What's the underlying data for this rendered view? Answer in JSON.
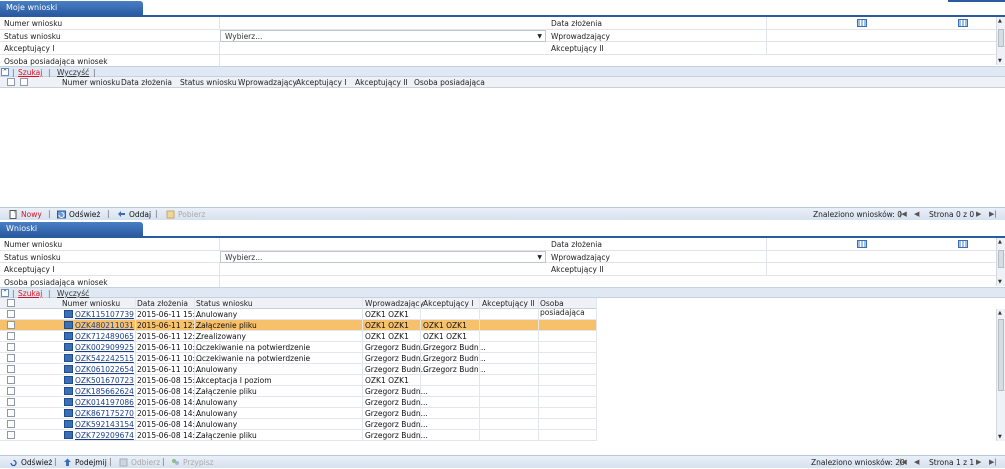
{
  "panel1": {
    "tab": "Moje wnioski",
    "filters": {
      "numer_label": "Numer wniosku",
      "status_label": "Status wniosku",
      "status_value": "Wybierz...",
      "akcept1_label": "Akceptujący I",
      "osoba_label": "Osoba posiadająca wniosek",
      "data_label": "Data złożenia",
      "wprow_label": "Wprowadzający",
      "akcept2_label": "Akceptujący II"
    },
    "search": {
      "szukaj": "Szukaj",
      "wyczysc": "Wyczyść"
    },
    "columns": [
      "Numer wniosku",
      "Data złożenia",
      "Status wniosku",
      "Wprowadzający",
      "Akceptujący I",
      "Akceptujący II",
      "Osoba posiadająca"
    ],
    "toolbar": {
      "nowy": "Nowy",
      "odswiez": "Odśwież",
      "oddaj": "Oddaj",
      "pobierz": "Pobierz"
    },
    "found": "Znaleziono wniosków: 0",
    "page": "Strona 0 z 0"
  },
  "panel2": {
    "tab": "Wnioski",
    "filters": {
      "numer_label": "Numer wniosku",
      "status_label": "Status wniosku",
      "status_value": "Wybierz...",
      "akcept1_label": "Akceptujący I",
      "osoba_label": "Osoba posiadająca wniosek",
      "data_label": "Data złożenia",
      "wprow_label": "Wprowadzający",
      "akcept2_label": "Akceptujący II"
    },
    "search": {
      "szukaj": "Szukaj",
      "wyczysc": "Wyczyść"
    },
    "columns": [
      "Numer wniosku",
      "Data złożenia",
      "Status wniosku",
      "Wprowadzający",
      "Akceptujący I",
      "Akceptujący II",
      "Osoba posiadająca"
    ],
    "rows": [
      {
        "num": "OZK115107739",
        "date": "2015-06-11 15:...",
        "status": "Anulowany",
        "wprow": "OZK1 OZK1",
        "ak1": "",
        "ak2": ""
      },
      {
        "num": "OZK480211031",
        "date": "2015-06-11 12:...",
        "status": "Załączenie pliku",
        "wprow": "OZK1 OZK1",
        "ak1": "OZK1 OZK1",
        "ak2": ""
      },
      {
        "num": "OZK712489065",
        "date": "2015-06-11 12:...",
        "status": "Zrealizowany",
        "wprow": "OZK1 OZK1",
        "ak1": "OZK1 OZK1",
        "ak2": ""
      },
      {
        "num": "OZK002909925",
        "date": "2015-06-11 10:...",
        "status": "Oczekiwanie na potwierdzenie",
        "wprow": "Grzegorz Budn...",
        "ak1": "Grzegorz Budn...",
        "ak2": ""
      },
      {
        "num": "OZK542242515",
        "date": "2015-06-11 10:...",
        "status": "Oczekiwanie na potwierdzenie",
        "wprow": "Grzegorz Budn...",
        "ak1": "Grzegorz Budn...",
        "ak2": ""
      },
      {
        "num": "OZK061022654",
        "date": "2015-06-11 10:...",
        "status": "Anulowany",
        "wprow": "Grzegorz Budn...",
        "ak1": "Grzegorz Budn...",
        "ak2": ""
      },
      {
        "num": "OZK501670723",
        "date": "2015-06-08 15:...",
        "status": "Akceptacja I poziom",
        "wprow": "OZK1 OZK1",
        "ak1": "",
        "ak2": ""
      },
      {
        "num": "OZK185662624",
        "date": "2015-06-08 14:...",
        "status": "Załączenie pliku",
        "wprow": "Grzegorz Budn...",
        "ak1": "",
        "ak2": ""
      },
      {
        "num": "OZK014197086",
        "date": "2015-06-08 14:...",
        "status": "Anulowany",
        "wprow": "Grzegorz Budn...",
        "ak1": "",
        "ak2": ""
      },
      {
        "num": "OZK867175270",
        "date": "2015-06-08 14:...",
        "status": "Anulowany",
        "wprow": "Grzegorz Budn...",
        "ak1": "",
        "ak2": ""
      },
      {
        "num": "OZK592143154",
        "date": "2015-06-08 14:...",
        "status": "Anulowany",
        "wprow": "Grzegorz Budn...",
        "ak1": "",
        "ak2": ""
      },
      {
        "num": "OZK729209674",
        "date": "2015-06-08 14:...",
        "status": "Załączenie pliku",
        "wprow": "Grzegorz Budn...",
        "ak1": "",
        "ak2": ""
      }
    ],
    "selected_row": 1,
    "toolbar": {
      "odswiez": "Odśwież",
      "podejmij": "Podejmij",
      "odbierz": "Odbierz",
      "przypisz": "Przypisz"
    },
    "found": "Znaleziono wniosków: 20",
    "page": "Strona 1 z 1"
  },
  "colors": {
    "accent": "#2a5aa0",
    "selected_row": "#f7c06a",
    "link": "#1b3f87",
    "search_red": "#dd1122"
  }
}
